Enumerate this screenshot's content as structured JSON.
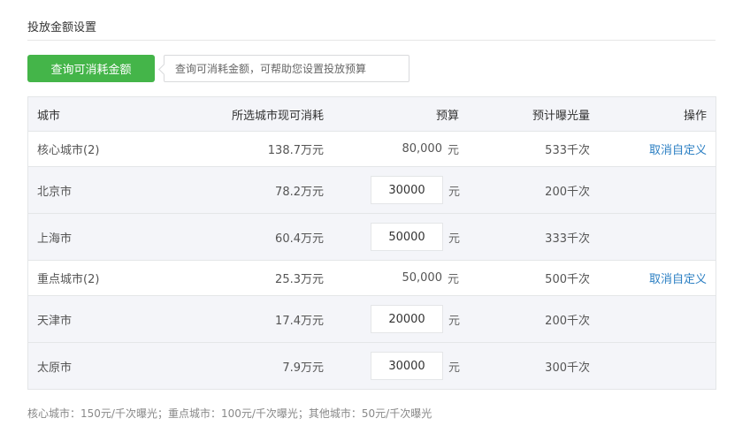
{
  "section": {
    "title": "投放金额设置"
  },
  "query": {
    "button_label": "查询可消耗金额",
    "tip": "查询可消耗金额，可帮助您设置投放预算"
  },
  "table": {
    "headers": {
      "city": "城市",
      "available": "所选城市现可消耗",
      "budget": "预算",
      "exposure": "预计曝光量",
      "action": "操作"
    },
    "rows": [
      {
        "kind": "group",
        "name": "核心城市(2)",
        "available": "138.7万元",
        "budget": "80,000",
        "unit": "元",
        "exposure": "533千次",
        "action": "取消自定义"
      },
      {
        "kind": "city",
        "name": "北京市",
        "available": "78.2万元",
        "budget": "30000",
        "unit": "元",
        "exposure": "200千次"
      },
      {
        "kind": "city",
        "name": "上海市",
        "available": "60.4万元",
        "budget": "50000",
        "unit": "元",
        "exposure": "333千次"
      },
      {
        "kind": "group",
        "name": "重点城市(2)",
        "available": "25.3万元",
        "budget": "50,000",
        "unit": "元",
        "exposure": "500千次",
        "action": "取消自定义"
      },
      {
        "kind": "city",
        "name": "天津市",
        "available": "17.4万元",
        "budget": "20000",
        "unit": "元",
        "exposure": "200千次"
      },
      {
        "kind": "city",
        "name": "太原市",
        "available": "7.9万元",
        "budget": "30000",
        "unit": "元",
        "exposure": "300千次"
      }
    ]
  },
  "footnote": "核心城市：150元/千次曝光；重点城市：100元/千次曝光；其他城市：50元/千次曝光",
  "colors": {
    "primary_button": "#44b549",
    "link": "#2b7fc3",
    "row_shade": "#f4f5f9"
  }
}
